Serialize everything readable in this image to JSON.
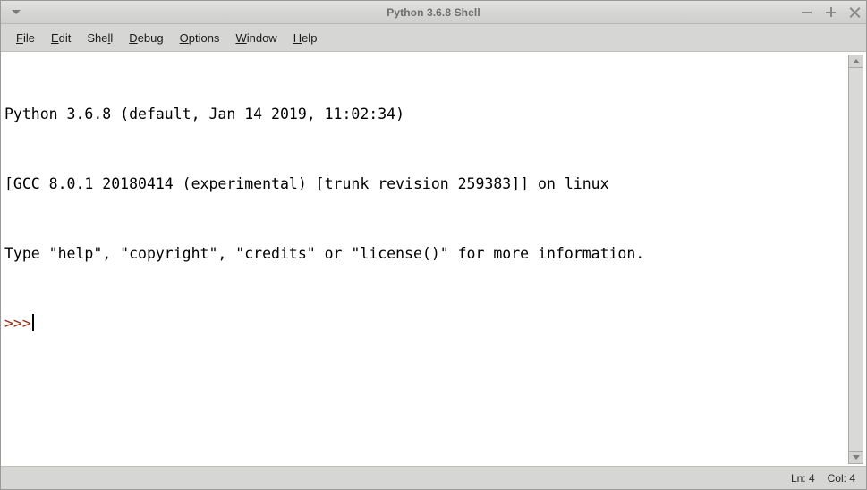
{
  "window": {
    "title": "Python 3.6.8 Shell",
    "window_menu_icon": "chevron-down-icon",
    "buttons": {
      "minimize": "minimize-icon",
      "maximize": "maximize-icon",
      "close": "close-icon"
    }
  },
  "menubar": {
    "items": [
      {
        "label": "File",
        "accel_index": 0
      },
      {
        "label": "Edit",
        "accel_index": 0
      },
      {
        "label": "Shell",
        "accel_index": 3
      },
      {
        "label": "Debug",
        "accel_index": 0
      },
      {
        "label": "Options",
        "accel_index": 0
      },
      {
        "label": "Window",
        "accel_index": 0
      },
      {
        "label": "Help",
        "accel_index": 0
      }
    ]
  },
  "shell": {
    "lines": [
      "Python 3.6.8 (default, Jan 14 2019, 11:02:34)",
      "[GCC 8.0.1 20180414 (experimental) [trunk revision 259383]] on linux",
      "Type \"help\", \"copyright\", \"credits\" or \"license()\" for more information."
    ],
    "prompt": ">>>",
    "input_value": "",
    "prompt_color": "#a42a0c",
    "text_color": "#000000",
    "background_color": "#ffffff"
  },
  "scrollbar": {
    "up_arrow_icon": "scroll-up-arrow-icon",
    "down_arrow_icon": "scroll-down-arrow-icon"
  },
  "statusbar": {
    "line_label": "Ln: 4",
    "col_label": "Col: 4"
  }
}
